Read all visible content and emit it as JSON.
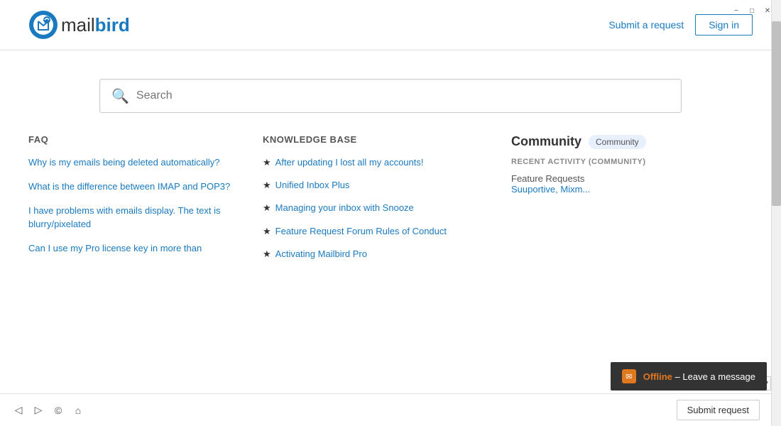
{
  "window": {
    "minimize_label": "−",
    "maximize_label": "□",
    "close_label": "✕"
  },
  "header": {
    "logo_alt": "Mailbird",
    "logo_text_plain": "mail",
    "logo_text_bold": "bird",
    "submit_request_label": "Submit a request",
    "sign_in_label": "Sign in"
  },
  "search": {
    "placeholder": "Search"
  },
  "faq": {
    "title": "FAQ",
    "items": [
      {
        "text": "Why is my emails being deleted automatically?"
      },
      {
        "text": "What is the difference between IMAP and POP3?"
      },
      {
        "text": "I have problems with emails display. The text is blurry/pixelated"
      },
      {
        "text": "Can I use my Pro license key in more than"
      }
    ]
  },
  "knowledge_base": {
    "title": "KNOWLEDGE BASE",
    "items": [
      {
        "text": "After updating I lost all my accounts!"
      },
      {
        "text": "Unified Inbox Plus"
      },
      {
        "text": "Managing your inbox with Snooze"
      },
      {
        "text": "Feature Request Forum Rules of Conduct"
      },
      {
        "text": "Activating Mailbird Pro"
      }
    ]
  },
  "community": {
    "title": "Community",
    "badge": "Community",
    "recent_activity_title": "RECENT ACTIVITY (COMMUNITY)",
    "activity_label": "Feature Requests",
    "activity_links": "Suuportive, Mixm..."
  },
  "offline_banner": {
    "status": "Offline",
    "label": "– Leave a message"
  },
  "footer": {
    "icons": [
      "◁",
      "▷",
      "©",
      "⌂"
    ],
    "submit_request_label": "Submit request"
  }
}
